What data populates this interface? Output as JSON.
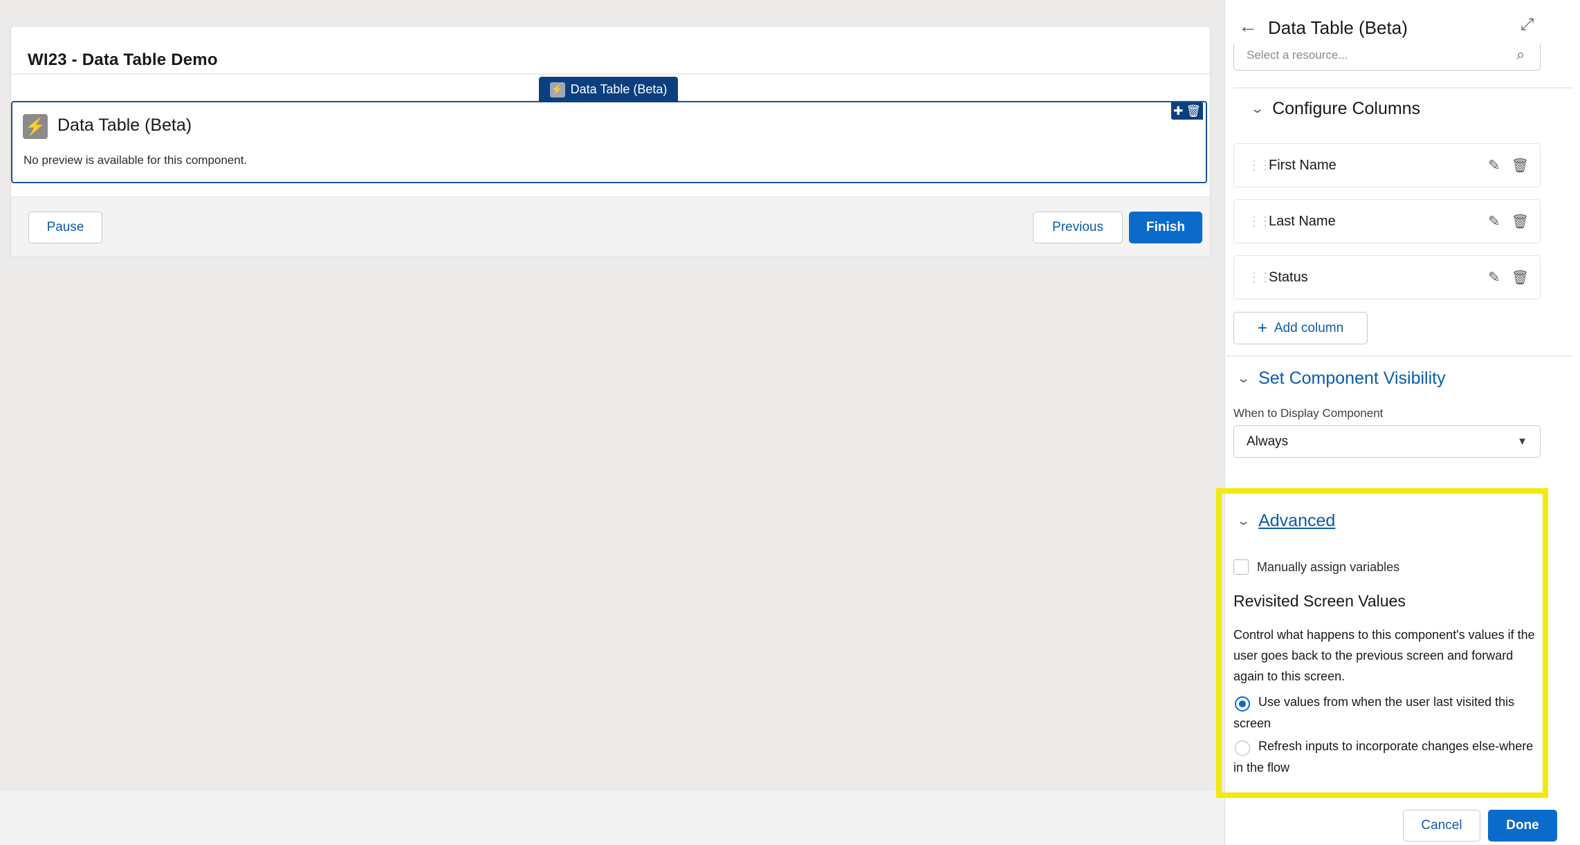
{
  "canvas": {
    "screen_title": "WI23 - Data Table Demo",
    "component_tag": "Data Table (Beta)",
    "component": {
      "name": "Data Table (Beta)",
      "preview_text": "No preview is available for this component."
    },
    "footer": {
      "pause_label": "Pause",
      "previous_label": "Previous",
      "finish_label": "Finish"
    }
  },
  "panel": {
    "title": "Data Table (Beta)",
    "resource_placeholder": "Select a resource...",
    "configure_columns": {
      "header": "Configure Columns",
      "columns": [
        {
          "label": "First Name"
        },
        {
          "label": "Last Name"
        },
        {
          "label": "Status"
        }
      ],
      "add_label": "Add column"
    },
    "visibility": {
      "header": "Set Component Visibility",
      "field_label": "When to Display Component",
      "selected": "Always"
    },
    "advanced": {
      "header": "Advanced",
      "manual_assign_label": "Manually assign variables",
      "manual_assign_checked": false,
      "revisited_heading": "Revisited Screen Values",
      "revisited_desc": "Control what happens to this component's values if the user goes back to the previous screen and forward again to this screen.",
      "options": [
        {
          "label": "Use values from when the user last visited this screen",
          "selected": true
        },
        {
          "label": "Refresh inputs to incorporate changes else-where in the flow",
          "selected": false
        }
      ]
    },
    "footer": {
      "cancel_label": "Cancel",
      "done_label": "Done"
    }
  },
  "colors": {
    "brand": "#0b6bcb",
    "selection_border": "#1b5297",
    "highlight": "#f2ea0d"
  }
}
